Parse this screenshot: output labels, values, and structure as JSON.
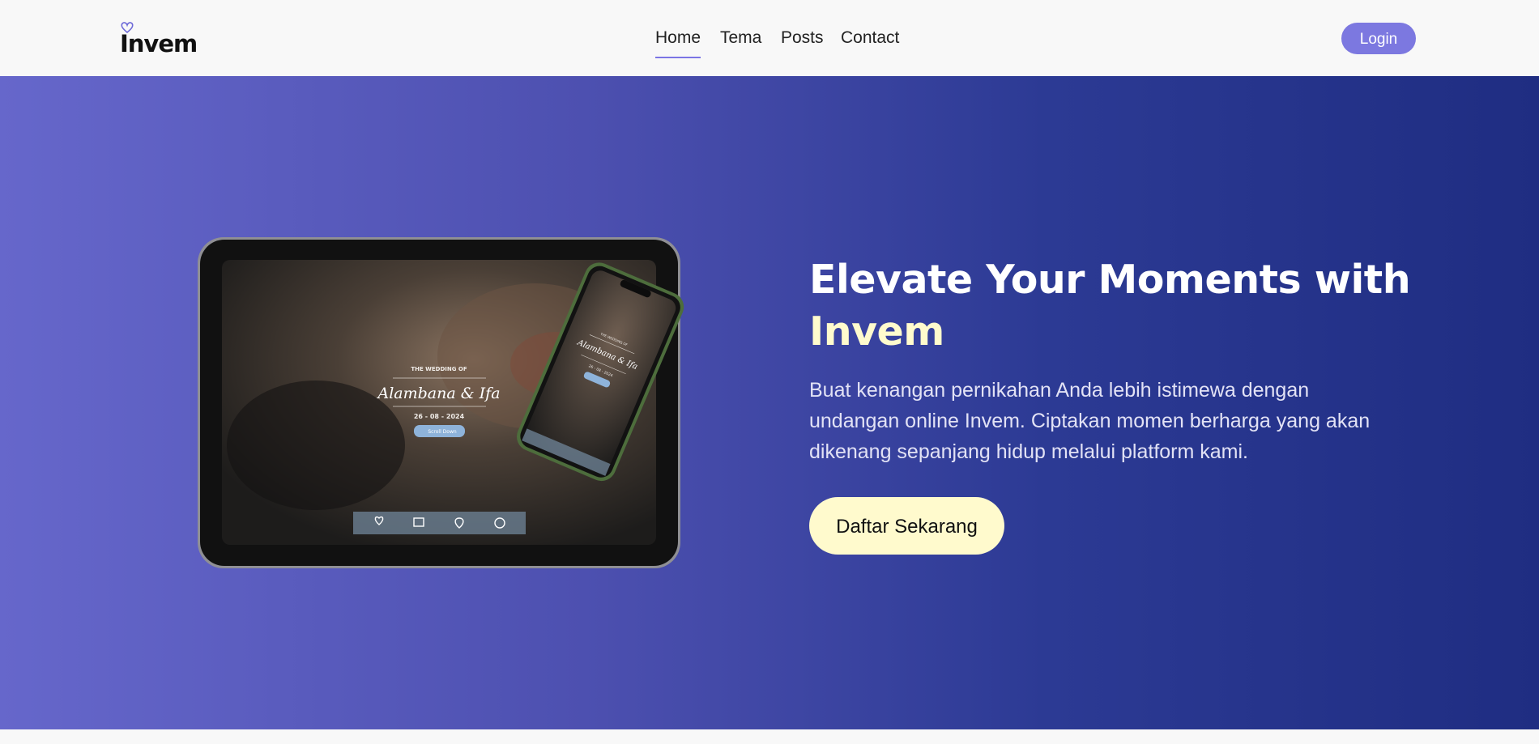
{
  "brand": {
    "name": "Invem"
  },
  "nav": {
    "items": [
      {
        "label": "Home",
        "active": true
      },
      {
        "label": "Tema"
      },
      {
        "label": "Posts"
      },
      {
        "label": "Contact"
      }
    ],
    "login_label": "Login"
  },
  "hero": {
    "title_main": "Elevate Your Moments with",
    "title_highlight": "Invem",
    "description": "Buat kenangan pernikahan Anda lebih istimewa dengan undangan online Invem. Ciptakan momen berharga yang akan dikenang sepanjang hidup melalui platform kami.",
    "cta_label": "Daftar Sekarang"
  },
  "mockup": {
    "wedding_of": "THE WEDDING OF",
    "couple_names": "Alambana & Ifa",
    "date": "26 - 08 - 2024",
    "scroll_label": "Scroll Down"
  },
  "colors": {
    "accent": "#7c78e0",
    "hero_gradient_start": "#6667cb",
    "hero_gradient_end": "#1f2d82",
    "highlight": "#fffbcd",
    "cta_bg": "#fffacd"
  }
}
